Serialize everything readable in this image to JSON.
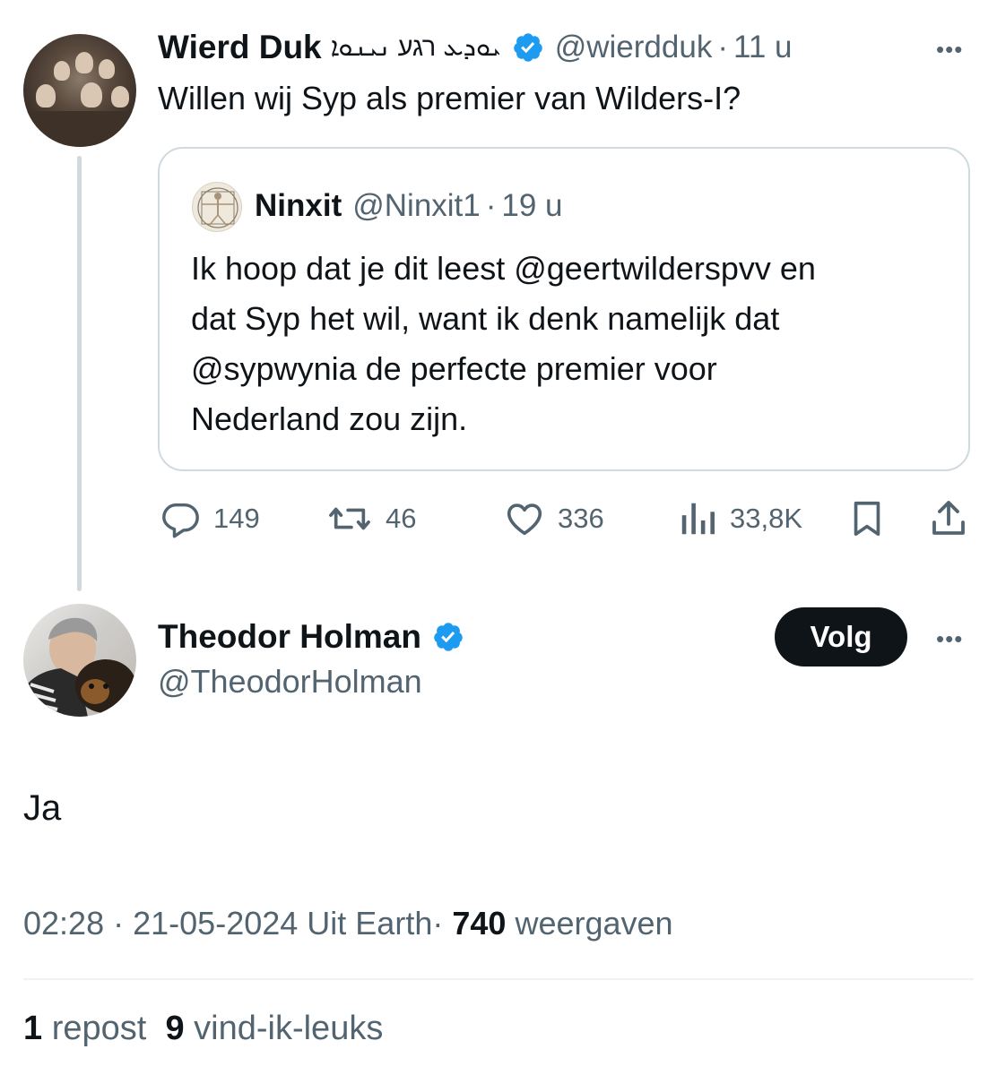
{
  "main_tweet": {
    "display_name": "Wierd Duk",
    "name_decoration": "ܝܘܕܥ רגע ܢܝܢܘܐ",
    "handle": "@wierdduk",
    "separator": "·",
    "time": "11 u",
    "more": "•••",
    "text": "Willen wij Syp als premier van Wilders-I?",
    "actions": {
      "replies": "149",
      "reposts": "46",
      "likes": "336",
      "views": "33,8K"
    }
  },
  "quoted_tweet": {
    "display_name": "Ninxit",
    "handle": "@Ninxit1",
    "separator": "·",
    "time": "19 u",
    "lines": [
      "Ik hoop dat je dit leest @geertwilderspvv  en",
      "dat Syp het wil, want ik denk namelijk dat",
      "@sypwynia de perfecte premier voor",
      "Nederland zou zijn."
    ]
  },
  "reply_tweet": {
    "display_name": "Theodor Holman",
    "handle": "@TheodorHolman",
    "follow_label": "Volg",
    "more": "•••",
    "text": "Ja",
    "time": "02:28",
    "sep1": "·",
    "date": "21-05-2024",
    "source": "Uit Earth",
    "sep2": "·",
    "views_count": "740",
    "views_label": "weergaven",
    "repost_count": "1",
    "repost_label": "repost",
    "likes_count": "9",
    "likes_label": "vind-ik-leuks"
  },
  "colors": {
    "text": "#0f1419",
    "secondary": "#536471",
    "verified": "#1d9bf0",
    "border": "#cfd9de"
  }
}
